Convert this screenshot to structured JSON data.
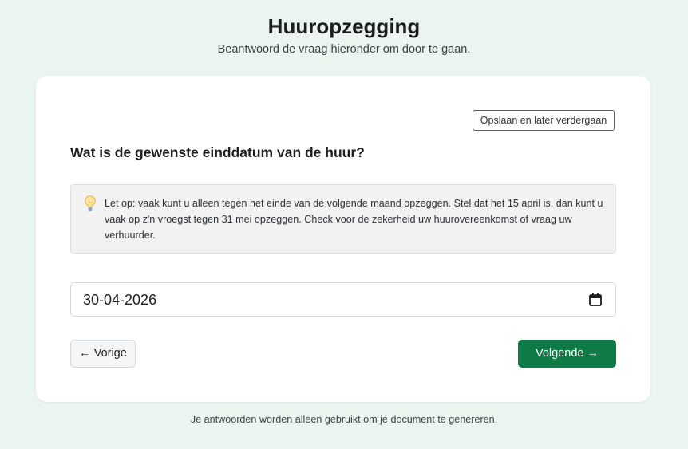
{
  "header": {
    "title": "Huuropzegging",
    "subtitle": "Beantwoord de vraag hieronder om door te gaan."
  },
  "card": {
    "save_later_label": "Opslaan en later verdergaan",
    "question": "Wat is de gewenste einddatum van de huur?",
    "hint": {
      "icon": "lightbulb-icon",
      "text": "Let op: vaak kunt u alleen tegen het einde van de volgende maand opzeggen. Stel dat het 15 april is, dan kunt u vaak op z'n vroegst tegen 31 mei opzeggen. Check voor de zekerheid uw huurovereenkomst of vraag uw verhuurder."
    },
    "date_input": {
      "value": "30-04-2026",
      "icon": "calendar-icon"
    },
    "prev_label": "← Vorige",
    "next_label": "Volgende →"
  },
  "footer": {
    "note": "Je antwoorden worden alleen gebruikt om je document te genereren."
  },
  "colors": {
    "background": "#ebf4ee",
    "primary": "#0f7a46",
    "hint_background": "#f2f2f2"
  }
}
